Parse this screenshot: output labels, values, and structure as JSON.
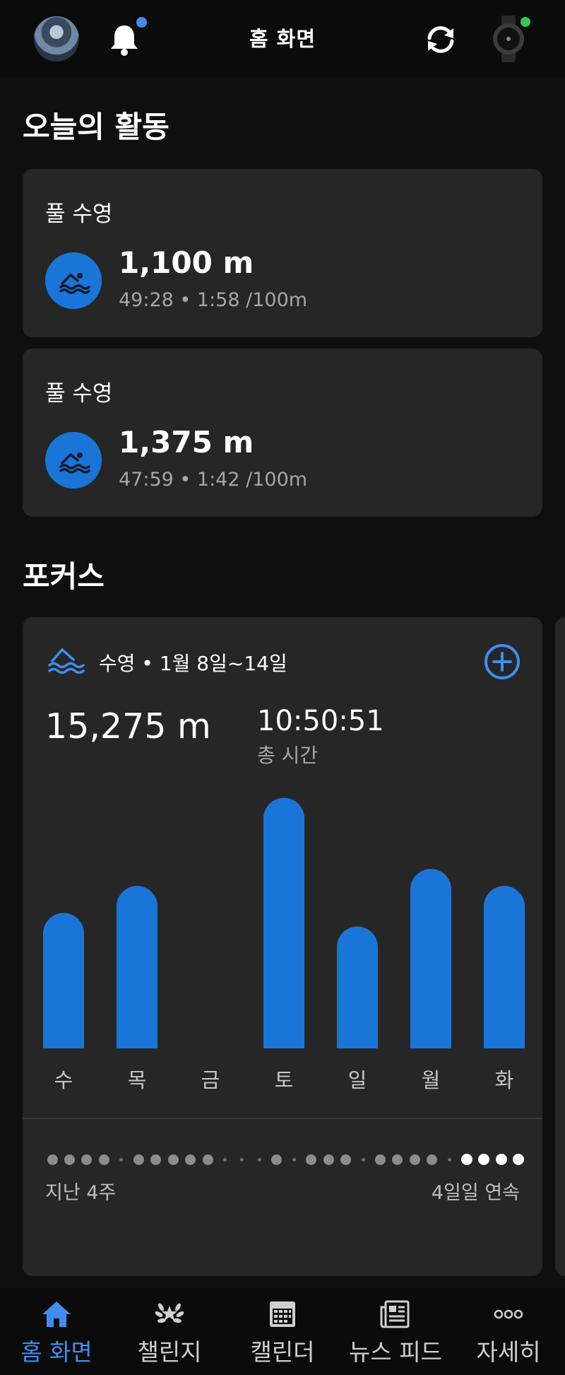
{
  "header": {
    "title": "홈 화면",
    "avatar": "user-profile-photo",
    "notification_icon": "bell-icon",
    "sync_icon": "sync-icon",
    "device_icon": "watch-icon"
  },
  "today": {
    "title": "오늘의 활동",
    "activities": [
      {
        "type": "풀 수영",
        "distance": "1,100 m",
        "meta": "49:28 • 1:58 /100m",
        "icon": "swim-icon"
      },
      {
        "type": "풀 수영",
        "distance": "1,375 m",
        "meta": "47:59 • 1:42 /100m",
        "icon": "swim-icon"
      }
    ]
  },
  "focus": {
    "title": "포커스",
    "header": "수영 • 1월 8일~14일",
    "add_icon": "plus-circle-icon",
    "total_distance": "15,275 m",
    "total_time": "10:50:51",
    "total_time_label": "총 시간",
    "streak_left_label": "지난 4주",
    "streak_right_label": "4일일 연속",
    "streak_dots": [
      "active",
      "active",
      "active",
      "active",
      "rest",
      "active",
      "active",
      "active",
      "active",
      "active",
      "rest",
      "rest",
      "rest",
      "active",
      "rest",
      "active",
      "active",
      "active",
      "rest",
      "active",
      "active",
      "active",
      "active",
      "rest",
      "current",
      "current",
      "current",
      "current"
    ]
  },
  "chart_data": {
    "type": "bar",
    "categories": [
      "수",
      "목",
      "금",
      "토",
      "일",
      "월",
      "화"
    ],
    "values": [
      2000,
      2400,
      0,
      3700,
      1800,
      2650,
      2400
    ],
    "ylim": [
      0,
      3800
    ],
    "color": "#1976d8",
    "grid": false
  },
  "colors": {
    "accent": "#3d8ef0",
    "bar": "#1976d8",
    "card": "#262626",
    "background": "#0f0f0f"
  },
  "nav": {
    "items": [
      {
        "label": "홈 화면",
        "icon": "home-icon",
        "active": true
      },
      {
        "label": "챌린지",
        "icon": "laurel-icon",
        "active": false
      },
      {
        "label": "캘린더",
        "icon": "calendar-icon",
        "active": false
      },
      {
        "label": "뉴스 피드",
        "icon": "newspaper-icon",
        "active": false
      },
      {
        "label": "자세히",
        "icon": "more-icon",
        "active": false
      }
    ]
  }
}
